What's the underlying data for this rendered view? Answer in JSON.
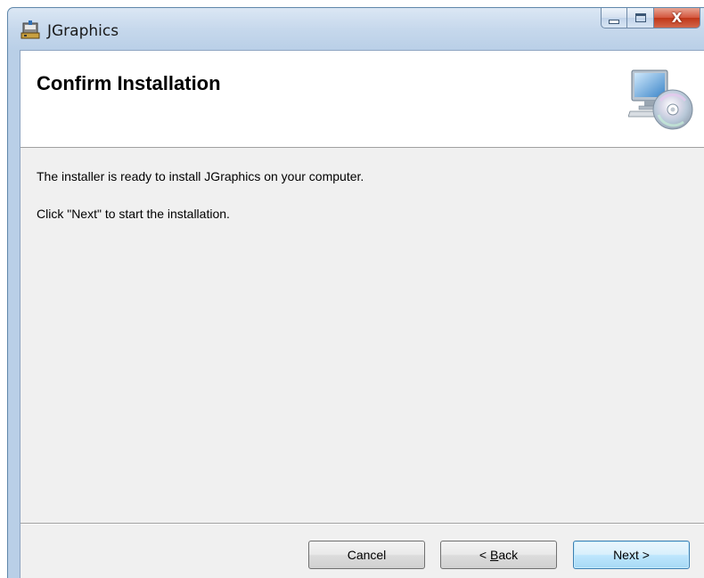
{
  "window": {
    "title": "JGraphics",
    "caption": {
      "minimize_icon": "minimize-icon",
      "maximize_icon": "maximize-icon",
      "close_glyph": "X"
    }
  },
  "header": {
    "title": "Confirm Installation",
    "icon": "computer-disc-icon"
  },
  "body": {
    "line1": "The installer is ready to install JGraphics on your computer.",
    "line2": "Click \"Next\" to start the installation."
  },
  "buttons": {
    "cancel": "Cancel",
    "back_prefix": "< ",
    "back_mnemonic": "B",
    "back_rest": "ack",
    "next": "Next >"
  },
  "colors": {
    "frame": "#b9cfe7",
    "close_button": "#c03618",
    "client_background": "#f0f0f0",
    "default_button": "#bee6fd"
  }
}
